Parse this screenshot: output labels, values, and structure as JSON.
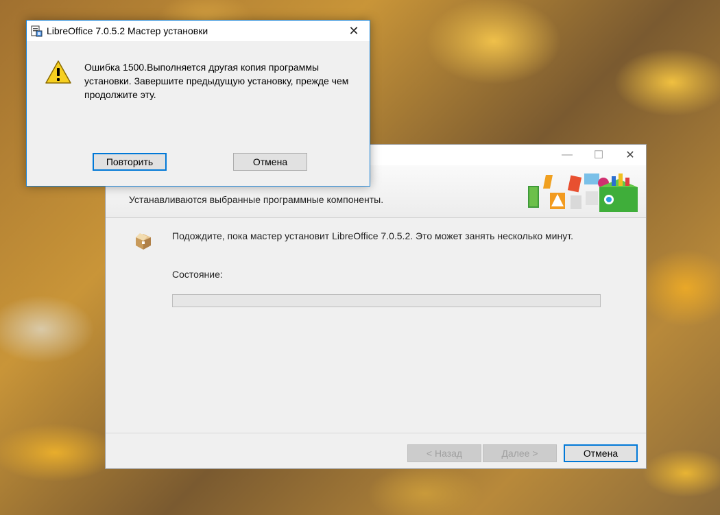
{
  "installer": {
    "window_buttons": {
      "minimize": "—",
      "maximize": "☐",
      "close": "✕"
    },
    "header_text": "Устанавливаются выбранные программные компоненты.",
    "wait_text": "Подождите, пока мастер установит LibreOffice 7.0.5.2. Это может занять несколько минут.",
    "status_label": "Состояние:",
    "progress": 0,
    "buttons": {
      "back": "< Назад",
      "next": "Далее >",
      "cancel": "Отмена"
    }
  },
  "dialog": {
    "title": "LibreOffice 7.0.5.2 Мастер установки",
    "close": "✕",
    "message": "Ошибка 1500.Выполняется другая копия программы установки. Завершите предыдущую установку, прежде чем продолжите эту.",
    "buttons": {
      "retry": "Повторить",
      "cancel": "Отмена"
    }
  },
  "colors": {
    "accent": "#0078d7",
    "warning": "#f2c200"
  },
  "icons": [
    "app-installer-icon",
    "warning-icon",
    "package-box-icon",
    "office-banner-icon",
    "close-icon"
  ]
}
